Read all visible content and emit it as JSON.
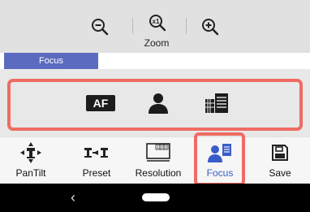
{
  "zoom": {
    "label": "Zoom",
    "zoom_out_icon": "zoom-out-icon",
    "zoom_reset_icon": "zoom-reset-icon",
    "zoom_in_icon": "zoom-in-icon"
  },
  "tabs": {
    "active_label": "Focus"
  },
  "focus_panel": {
    "af_label": "AF",
    "options": [
      "autofocus",
      "face-detect",
      "manual-focus"
    ]
  },
  "toolbar": {
    "items": [
      {
        "label": "PanTilt",
        "icon": "pan-tilt-icon"
      },
      {
        "label": "Preset",
        "icon": "preset-icon"
      },
      {
        "label": "Resolution",
        "icon": "resolution-icon"
      },
      {
        "label": "Focus",
        "icon": "focus-icon",
        "active": true
      },
      {
        "label": "Save",
        "icon": "save-icon"
      }
    ]
  },
  "colors": {
    "accent": "#3a5cc9",
    "tab_bg": "#5b6bbf",
    "highlight": "#ef6b63"
  },
  "navbar": {
    "back_glyph": "‹"
  }
}
